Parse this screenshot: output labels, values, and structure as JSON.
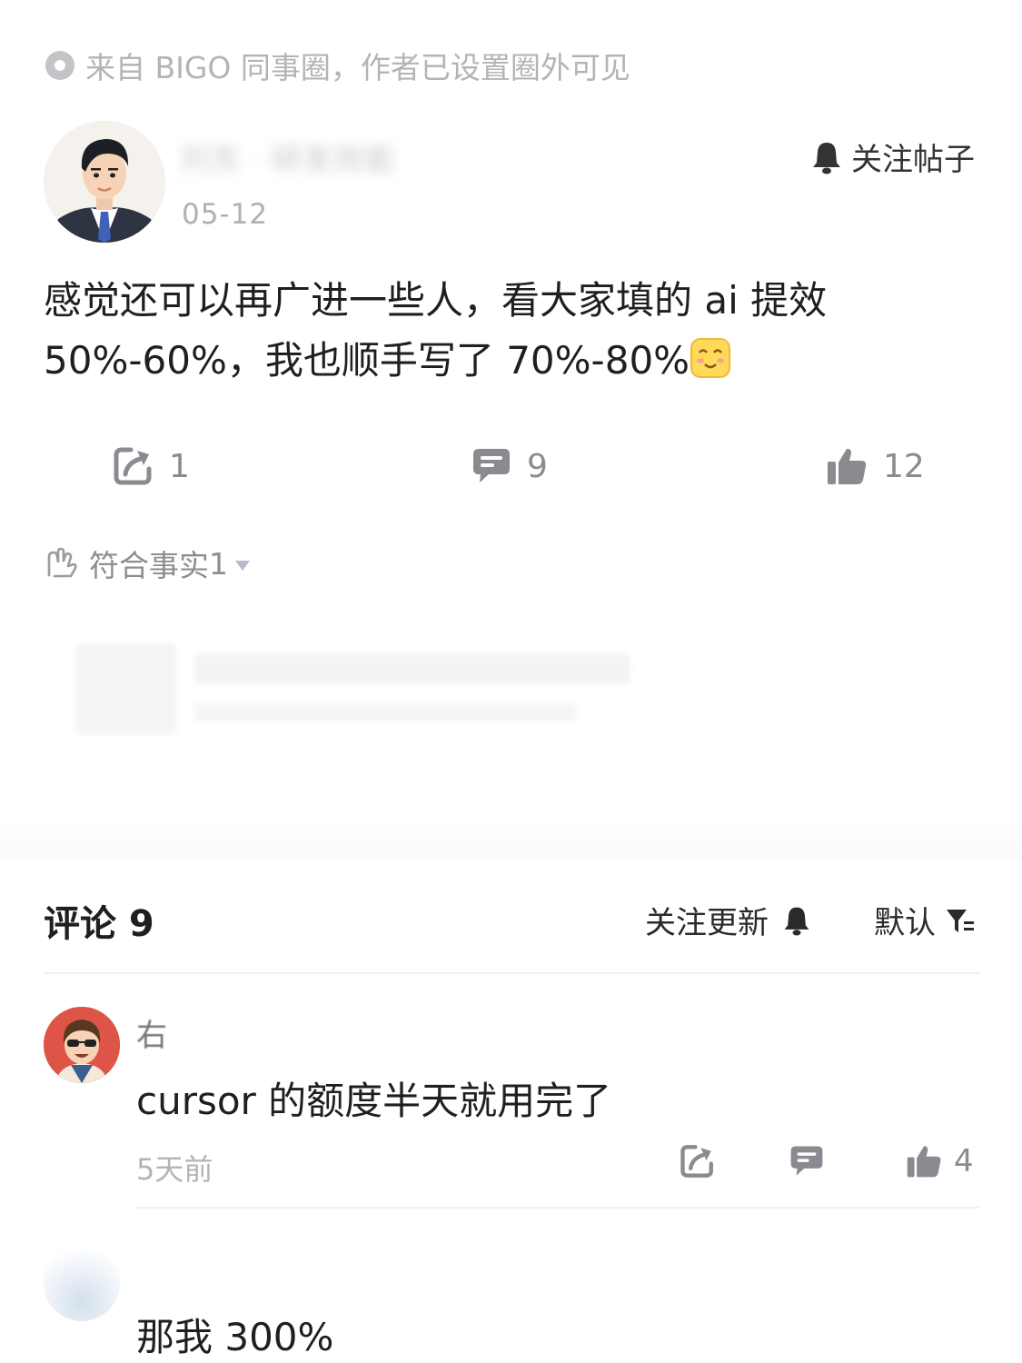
{
  "source": {
    "text": "来自 BIGO 同事圈，作者已设置圈外可见",
    "icon": "circle-dot-icon"
  },
  "post": {
    "author": "刘东 · 研发效能",
    "date": "05-12",
    "follow_label": "关注帖子",
    "body_line1": "感觉还可以再广进一些人，看大家填的 ai 提效",
    "body_line2": "50%-60%，我也顺手写了 70%-80%",
    "emoji": "blushing-smile-emoji",
    "actions": {
      "share_count": "1",
      "comment_count": "9",
      "like_count": "12"
    },
    "reaction": {
      "label": "符合事实",
      "count": "1"
    }
  },
  "comments_section": {
    "title": "评论 9",
    "follow_updates_label": "关注更新",
    "sort_label": "默认",
    "comments": [
      {
        "author": "右",
        "text": "cursor 的额度半天就用完了",
        "time": "5天前",
        "like_count": "4"
      },
      {
        "text": "那我 300%"
      }
    ]
  },
  "colors": {
    "icon_gray": "#8a8a90",
    "text_dark": "#1f1f1f",
    "muted": "#b3b3b8",
    "comment_avatar_bg": "#de5548"
  }
}
